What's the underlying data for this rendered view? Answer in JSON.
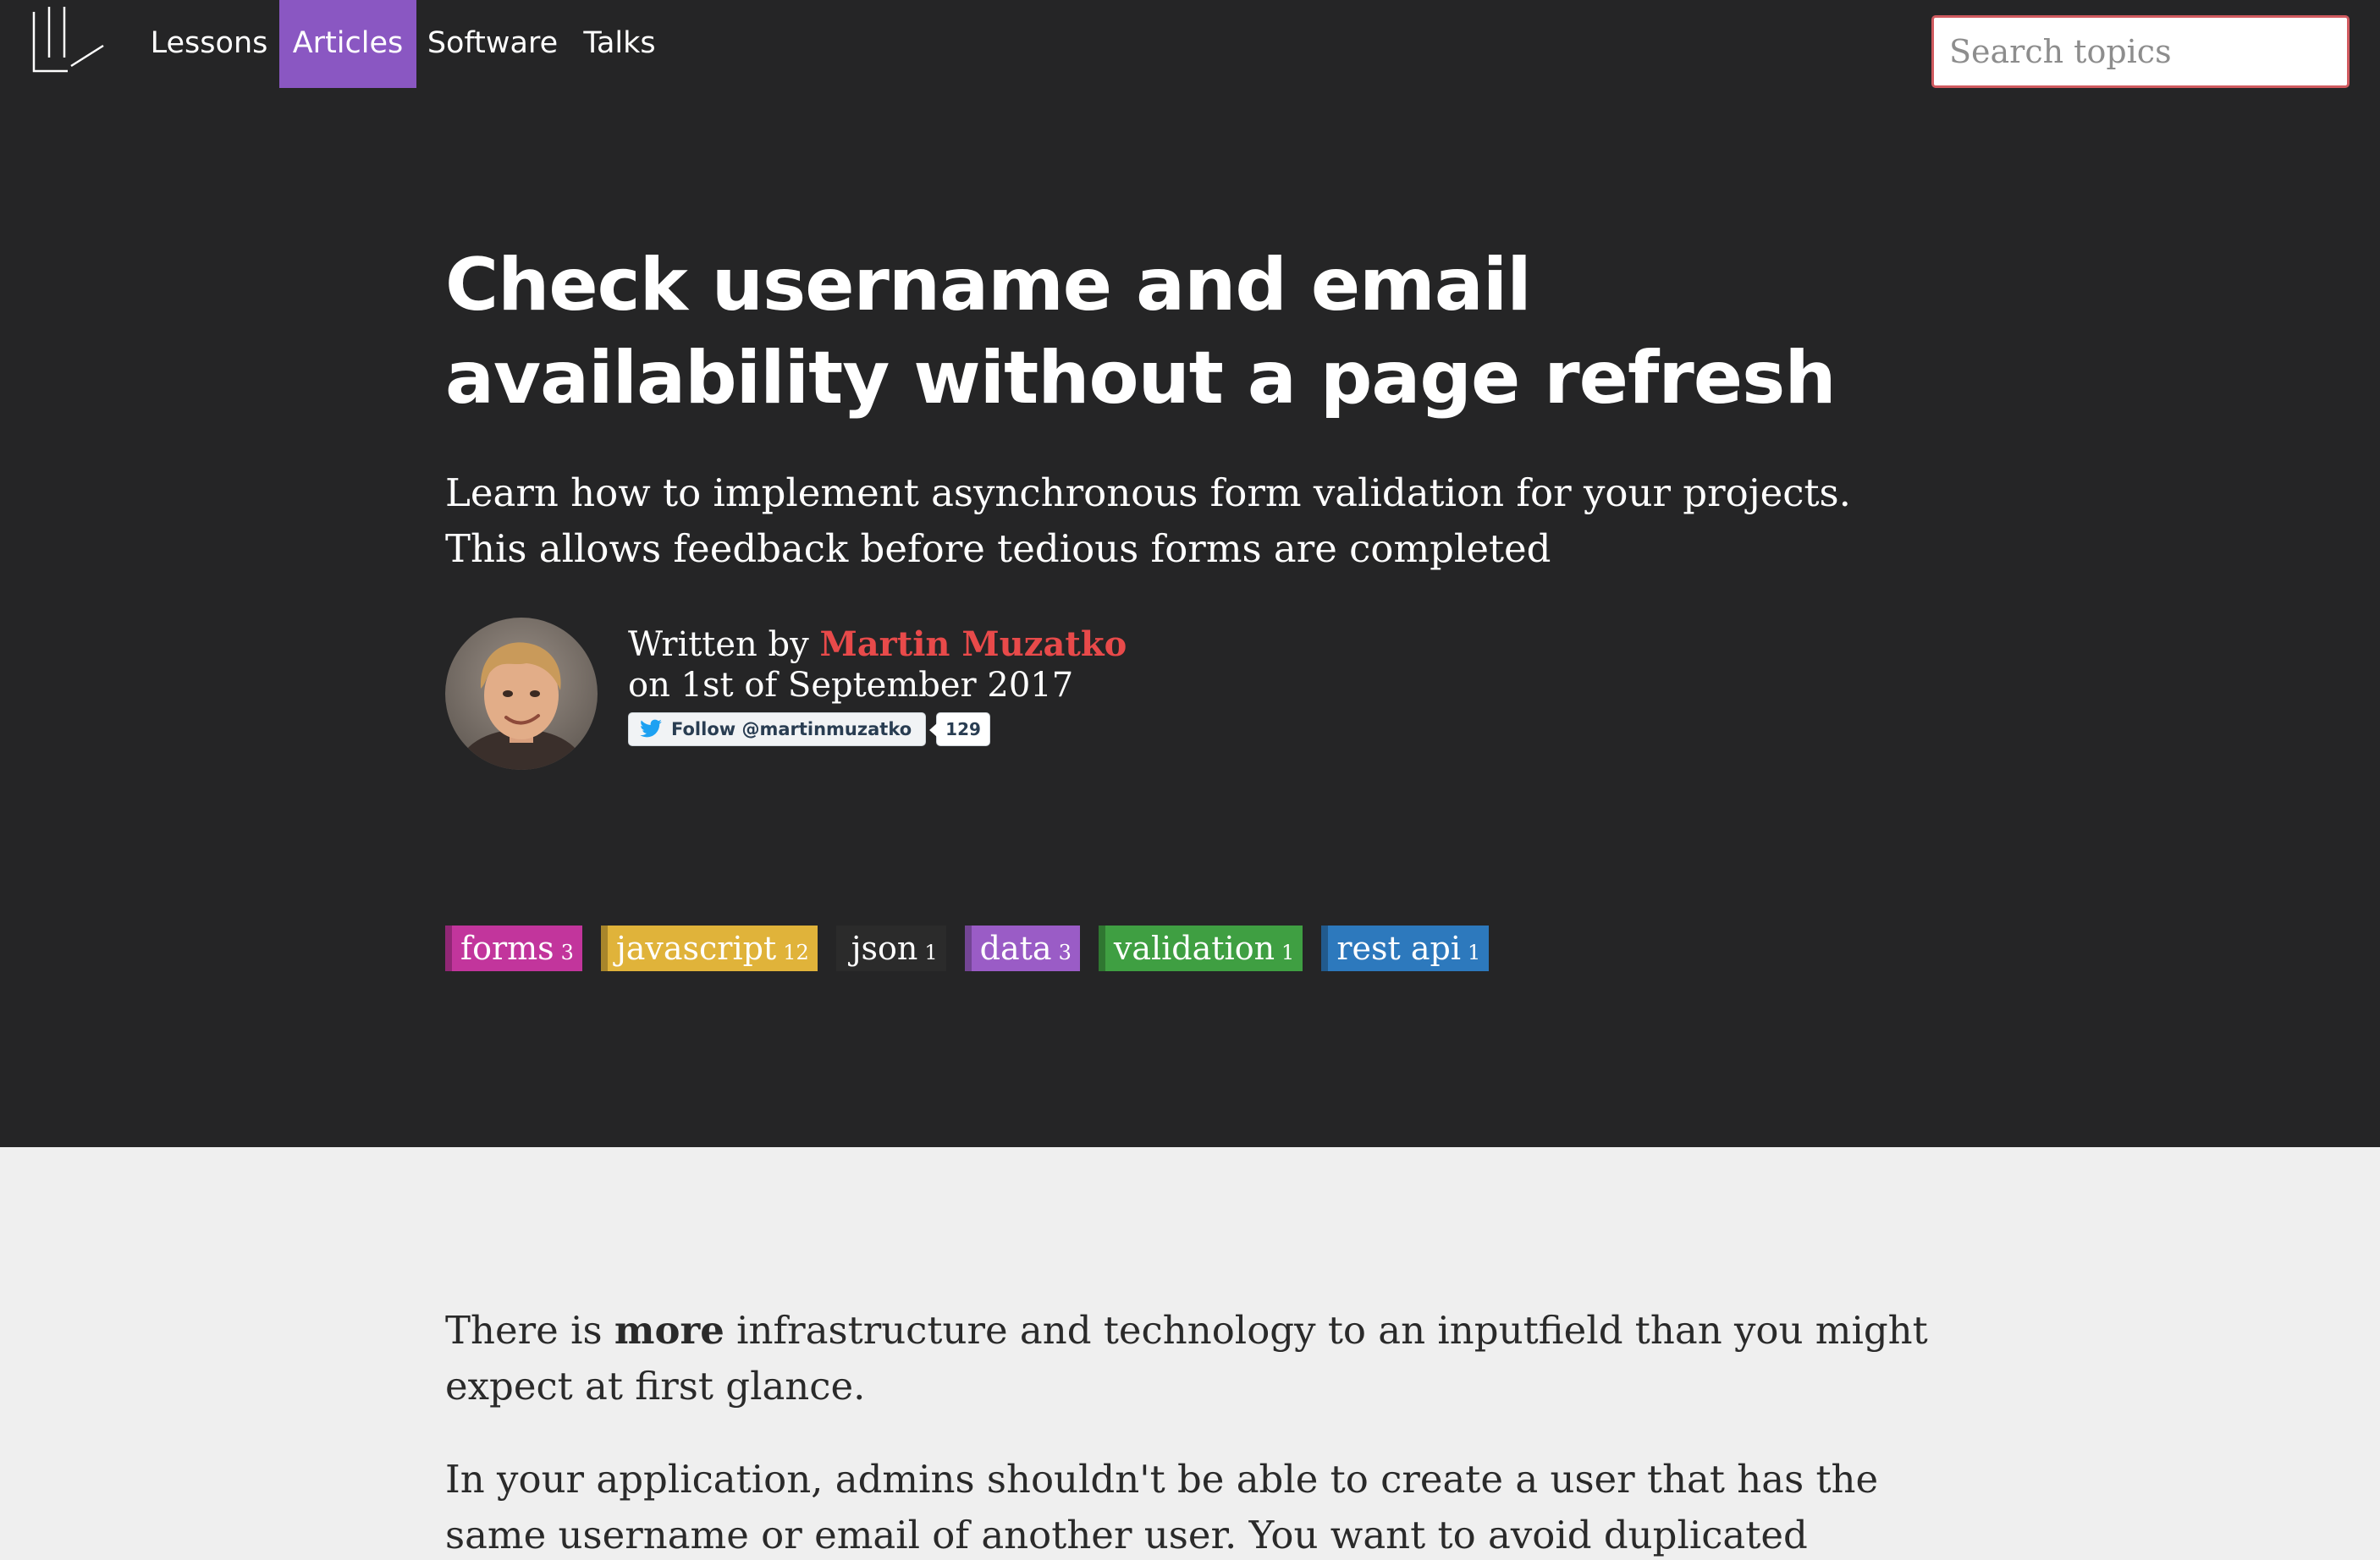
{
  "nav": {
    "items": [
      {
        "label": "Lessons",
        "active": false
      },
      {
        "label": "Articles",
        "active": true
      },
      {
        "label": "Software",
        "active": false
      },
      {
        "label": "Talks",
        "active": false
      }
    ],
    "search_placeholder": "Search topics"
  },
  "article": {
    "title": "Check username and email availability without a page refresh",
    "subtitle": "Learn how to implement asynchronous form validation for your projects. This allows feedback before tedious forms are completed",
    "written_by": "Written by",
    "author": "Martin Muzatko",
    "date": "on 1st of September 2017",
    "follow_label": "Follow @martinmuzatko",
    "follow_count": "129",
    "tags": [
      {
        "name": "forms",
        "count": "3",
        "color": "#c2359c"
      },
      {
        "name": "javascript",
        "count": "12",
        "color": "#e0b33a"
      },
      {
        "name": "json",
        "count": "1",
        "color": "#2b2b2b"
      },
      {
        "name": "data",
        "count": "3",
        "color": "#9a5cc6"
      },
      {
        "name": "validation",
        "count": "1",
        "color": "#3f9f42"
      },
      {
        "name": "rest api",
        "count": "1",
        "color": "#2d79bd"
      }
    ]
  },
  "body": {
    "p1_before": "There is ",
    "p1_bold": "more",
    "p1_after": " infrastructure and technology to an inputfield than you might expect at first glance.",
    "p2": "In your application, admins shouldn't be able to create a user that has the same username or email of another user. You want to avoid duplicated entries. But when"
  },
  "colors": {
    "background_dark": "#252526",
    "background_light": "#efefef",
    "accent_purple": "#8a57c2",
    "author_red": "#e84a4a"
  }
}
